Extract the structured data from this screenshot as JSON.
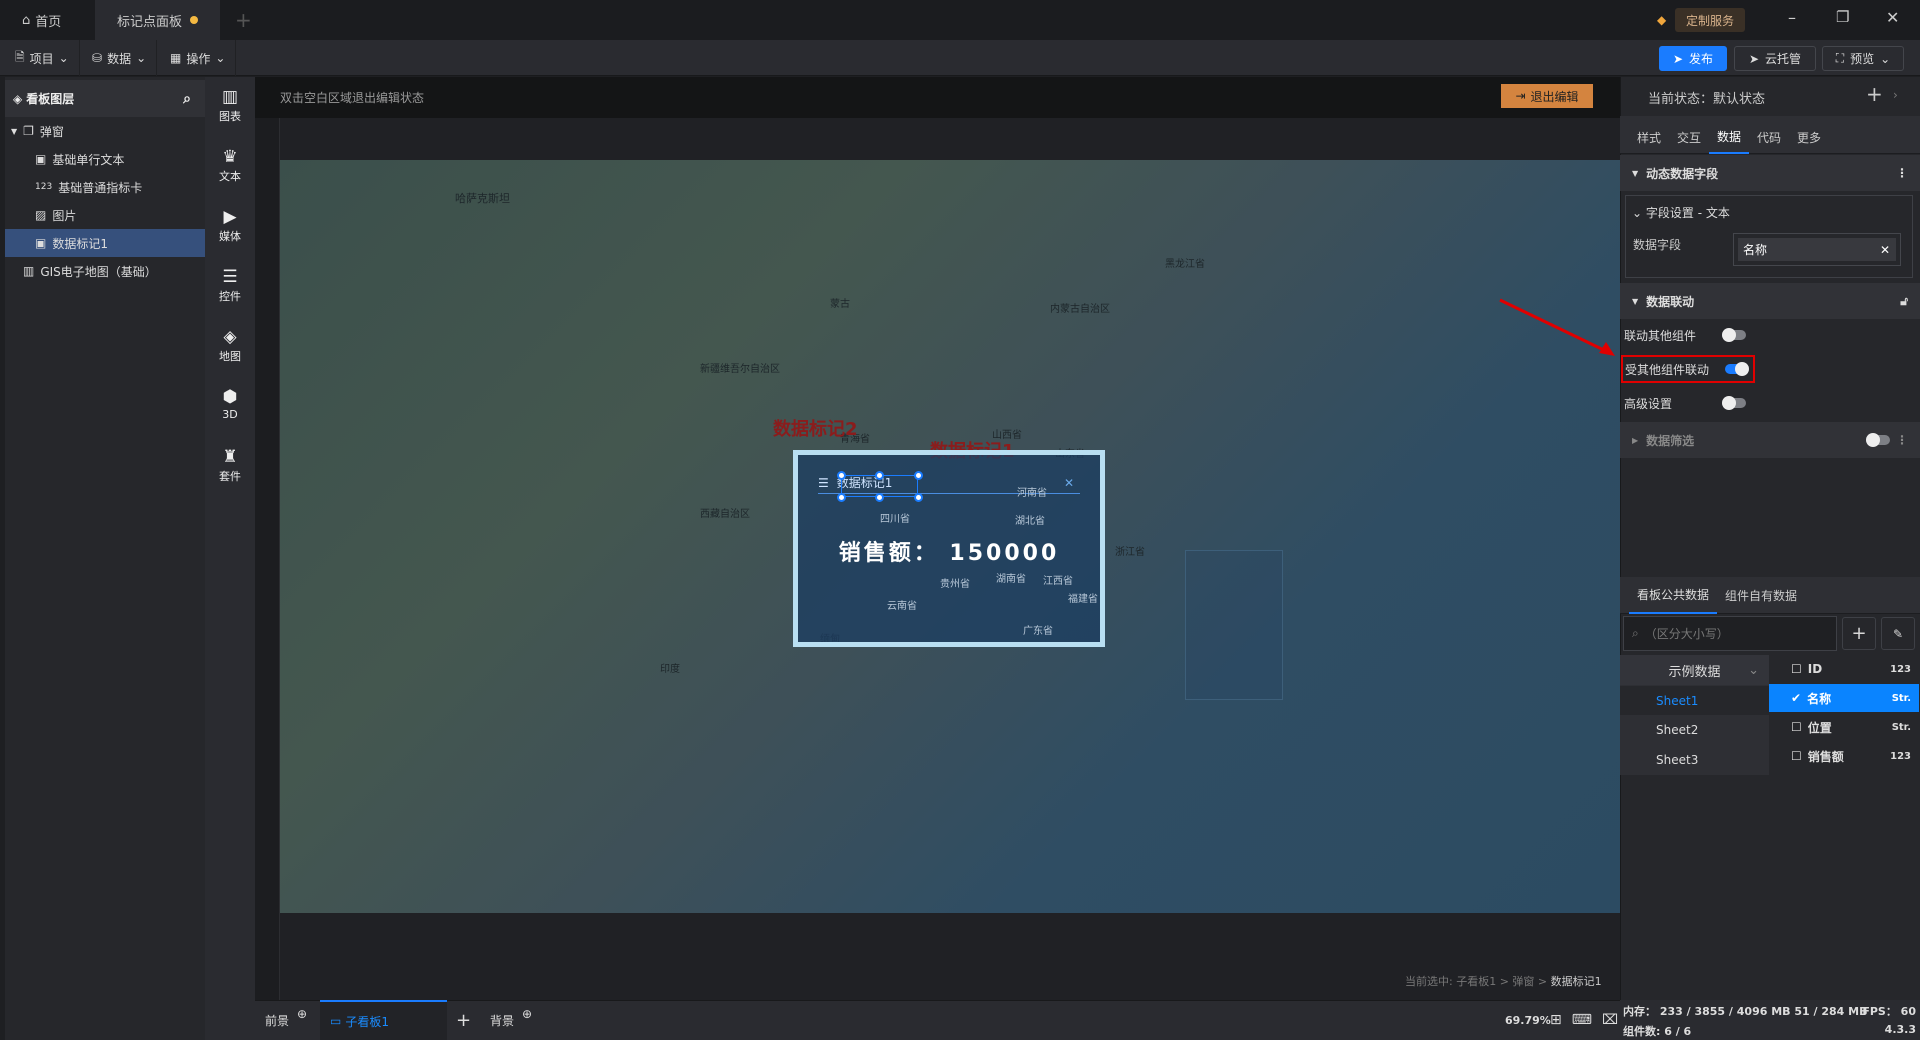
{
  "titlebar": {
    "tabs": [
      {
        "label": "首页",
        "icon": "home-icon"
      },
      {
        "label": "标记点面板",
        "unsaved": true
      }
    ],
    "add_tab": "+",
    "custom_service": "定制服务"
  },
  "toolbar": {
    "menus": [
      "项目",
      "数据",
      "操作"
    ],
    "publish": "发布",
    "cloud": "云托管",
    "preview": "预览"
  },
  "left_panel": {
    "title": "看板图层",
    "tree": [
      {
        "label": "弹窗",
        "level": 0,
        "icon": "popup-icon"
      },
      {
        "label": "基础单行文本",
        "level": 1,
        "icon": "text-icon"
      },
      {
        "label": "基础普通指标卡",
        "level": 1,
        "icon": "number-card-icon"
      },
      {
        "label": "图片",
        "level": 1,
        "icon": "image-icon"
      },
      {
        "label": "数据标记1",
        "level": 1,
        "icon": "text-icon",
        "selected": true
      },
      {
        "label": "GIS电子地图（基础）",
        "level": 0,
        "icon": "map-icon"
      }
    ]
  },
  "components": [
    {
      "label": "图表",
      "glyph": "▥"
    },
    {
      "label": "文本",
      "glyph": "♛"
    },
    {
      "label": "媒体",
      "glyph": "▶"
    },
    {
      "label": "控件",
      "glyph": "☰"
    },
    {
      "label": "地图",
      "glyph": "◈"
    },
    {
      "label": "3D",
      "glyph": "⬢"
    },
    {
      "label": "套件",
      "glyph": "♜"
    }
  ],
  "canvas": {
    "hint": "双击空白区域退出编辑状态",
    "exit_edit": "退出编辑",
    "selection_path_prefix": "当前选中: 子看板1 > 弹窗 > ",
    "selection_path_last": "数据标记1",
    "map_labels": [
      "新疆维吾尔自治区",
      "西藏自治区",
      "青海省",
      "四川省",
      "贵州省",
      "云南省",
      "湖南省",
      "江西省",
      "湖北省",
      "河南省",
      "山西省",
      "山东省",
      "浙江省",
      "福建省",
      "广东省",
      "内蒙古自治区",
      "黑龙江省",
      "哈萨克斯坦",
      "蒙古",
      "印度",
      "缅甸"
    ],
    "markers": [
      "数据标记2",
      "数据标记1"
    ],
    "popup": {
      "title": "数据标记1",
      "label": "销售额：",
      "value": "150000"
    }
  },
  "bottom": {
    "tabs": [
      "前景",
      "子看板1",
      "背景"
    ],
    "zoom": "69.79%"
  },
  "right_panel": {
    "state_label": "当前状态：默认状态",
    "tabs": [
      "样式",
      "交互",
      "数据",
      "代码",
      "更多"
    ],
    "active_tab": "数据",
    "dynamic_fields": "动态数据字段",
    "field_setting": "字段设置 - 文本",
    "data_field_label": "数据字段",
    "data_field_value": "名称",
    "linkage": {
      "title": "数据联动",
      "items": [
        {
          "label": "联动其他组件",
          "on": false
        },
        {
          "label": "受其他组件联动",
          "on": true
        },
        {
          "label": "高级设置",
          "on": false
        }
      ]
    },
    "filter": {
      "label": "数据筛选",
      "on": false
    },
    "data_tabs": [
      "看板公共数据",
      "组件自有数据"
    ],
    "search_placeholder": "（区分大小写）",
    "source": "示例数据",
    "sheets": [
      "Sheet1",
      "Sheet2",
      "Sheet3"
    ],
    "active_sheet": "Sheet1",
    "fields": [
      {
        "name": "ID",
        "type": "123",
        "checked": false
      },
      {
        "name": "名称",
        "type": "Str.",
        "checked": true
      },
      {
        "name": "位置",
        "type": "Str.",
        "checked": false
      },
      {
        "name": "销售额",
        "type": "123",
        "checked": false
      }
    ]
  },
  "status": {
    "memory": "内存： 233 / 3855 / 4096 MB  51 / 284 MB",
    "fps": "FPS： 60",
    "components": "组件数: 6 / 6",
    "version": "4.3.3"
  },
  "colors": {
    "accent": "#1a7cff",
    "exit": "#d4843f",
    "highlight": "#e00000"
  }
}
